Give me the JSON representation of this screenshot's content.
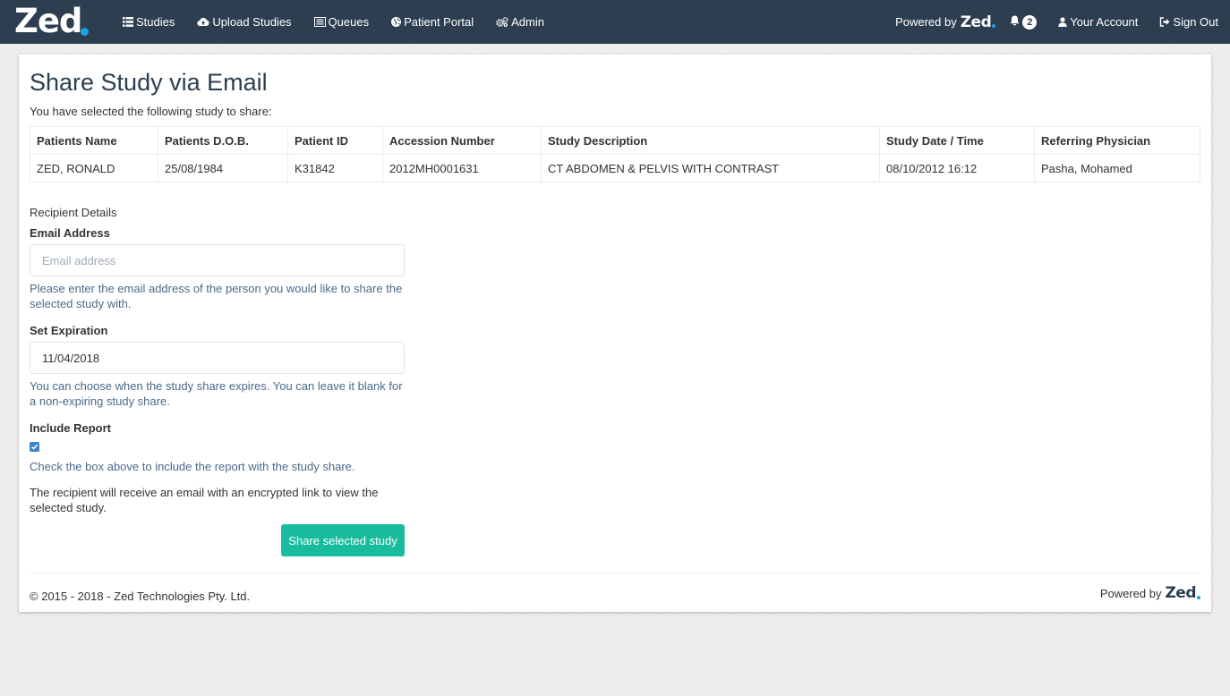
{
  "colors": {
    "navbar": "#2c3e50",
    "accent": "#18bc9c",
    "brand_dot": "#1aa4e0",
    "help_text": "#4a6a8a"
  },
  "brand": {
    "logo_text": "Zed"
  },
  "nav": {
    "items": [
      {
        "label": "Studies",
        "icon": "list-icon"
      },
      {
        "label": "Upload Studies",
        "icon": "cloud-upload-icon"
      },
      {
        "label": "Queues",
        "icon": "queue-list-icon"
      },
      {
        "label": "Patient Portal",
        "icon": "globe-icon"
      },
      {
        "label": "Admin",
        "icon": "cogs-icon"
      }
    ],
    "powered_by": "Powered by",
    "powered_logo": "Zed",
    "notification_count": "2",
    "account_label": "Your Account",
    "signout_label": "Sign Out"
  },
  "page": {
    "title": "Share Study via Email",
    "intro": "You have selected the following study to share:"
  },
  "study_table": {
    "headers": [
      "Patients Name",
      "Patients D.O.B.",
      "Patient ID",
      "Accession Number",
      "Study Description",
      "Study Date / Time",
      "Referring Physician"
    ],
    "rows": [
      [
        "ZED, RONALD",
        "25/08/1984",
        "K31842",
        "2012MH0001631",
        "CT ABDOMEN & PELVIS WITH CONTRAST",
        "08/10/2012 16:12",
        "Pasha, Mohamed"
      ]
    ]
  },
  "form": {
    "section_label": "Recipient Details",
    "email": {
      "label": "Email Address",
      "placeholder": "Email address",
      "value": "",
      "help": "Please enter the email address of the person you would like to share the selected study with."
    },
    "expiration": {
      "label": "Set Expiration",
      "value": "11/04/2018",
      "help": "You can choose when the study share expires. You can leave it blank for a non-expiring study share."
    },
    "report": {
      "label": "Include Report",
      "checked": true,
      "help": "Check the box above to include the report with the study share."
    },
    "note": "The recipient will receive an email with an encrypted link to view the selected study.",
    "submit_label": "Share selected study"
  },
  "footer": {
    "copyright": "© 2015 - 2018 - Zed Technologies Pty. Ltd.",
    "powered_by": "Powered by",
    "powered_logo": "Zed"
  }
}
